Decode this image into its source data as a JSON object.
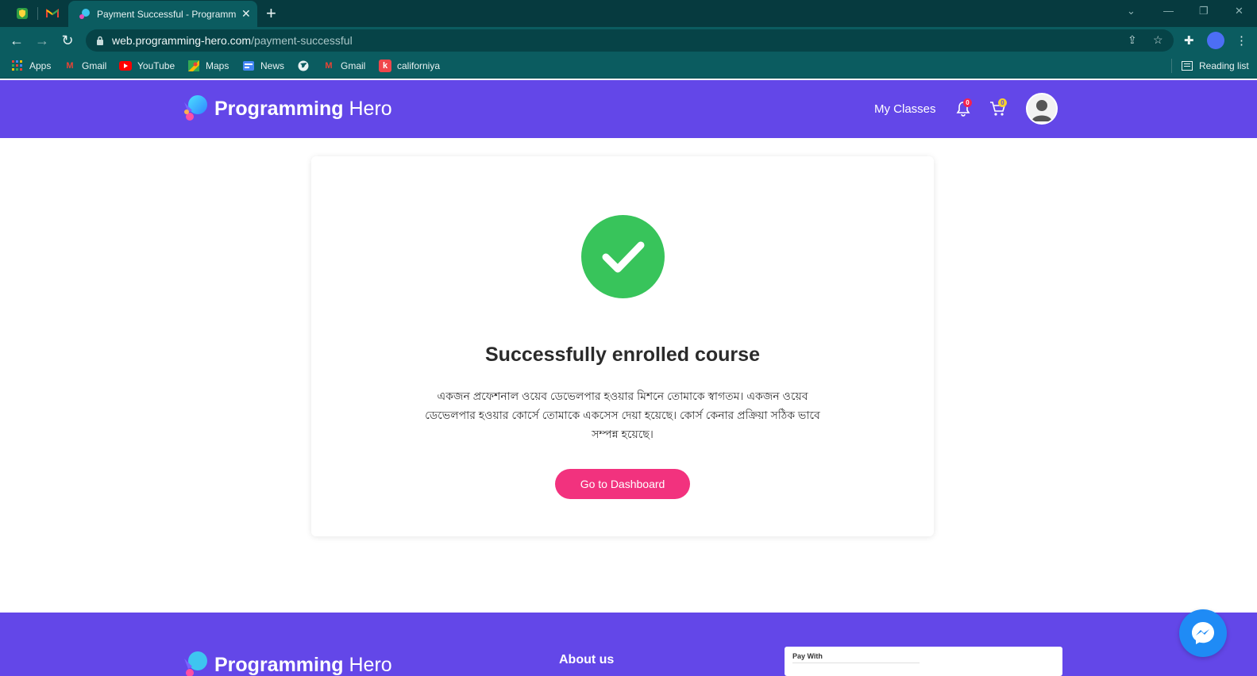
{
  "browser": {
    "active_tab_title": "Payment Successful - Programming Hero",
    "tab_close": "✕",
    "new_tab": "+",
    "url_host": "web.programming-hero.com",
    "url_path": "/payment-successful",
    "bookmarks": [
      {
        "label": "Apps",
        "icon": "apps-grid-icon"
      },
      {
        "label": "Gmail",
        "icon": "gmail-icon"
      },
      {
        "label": "YouTube",
        "icon": "youtube-icon"
      },
      {
        "label": "Maps",
        "icon": "maps-icon"
      },
      {
        "label": "News",
        "icon": "news-icon"
      },
      {
        "label": "",
        "icon": "globe-icon"
      },
      {
        "label": "Gmail",
        "icon": "gmail-icon"
      },
      {
        "label": "californiya",
        "icon": "k-icon"
      }
    ],
    "reading_list": "Reading list"
  },
  "header": {
    "logo_bold": "Programming",
    "logo_light": "Hero",
    "nav_my_classes": "My Classes",
    "notification_count": "0",
    "cart_count": "0",
    "colors": {
      "header_bg": "#6347e8",
      "badge_red": "#f5224f",
      "badge_yellow": "#f6d130"
    }
  },
  "main": {
    "title": "Successfully enrolled course",
    "message": "একজন প্রফেশনাল ওয়েব ডেভেলপার হওয়ার মিশনে তোমাকে স্বাগতম। একজন ওয়েব ডেভেলপার হওয়ার কোর্সে তোমাকে একসেস দেয়া হয়েছে। কোর্স কেনার প্রক্রিয়া সঠিক ভাবে সম্পন্ন হয়েছে।",
    "button_label": "Go to Dashboard",
    "colors": {
      "success": "#38c45b",
      "button": "#f2327e"
    }
  },
  "footer": {
    "logo_bold": "Programming",
    "logo_light": "Hero",
    "about_heading": "About us",
    "pay_with": "Pay With"
  }
}
